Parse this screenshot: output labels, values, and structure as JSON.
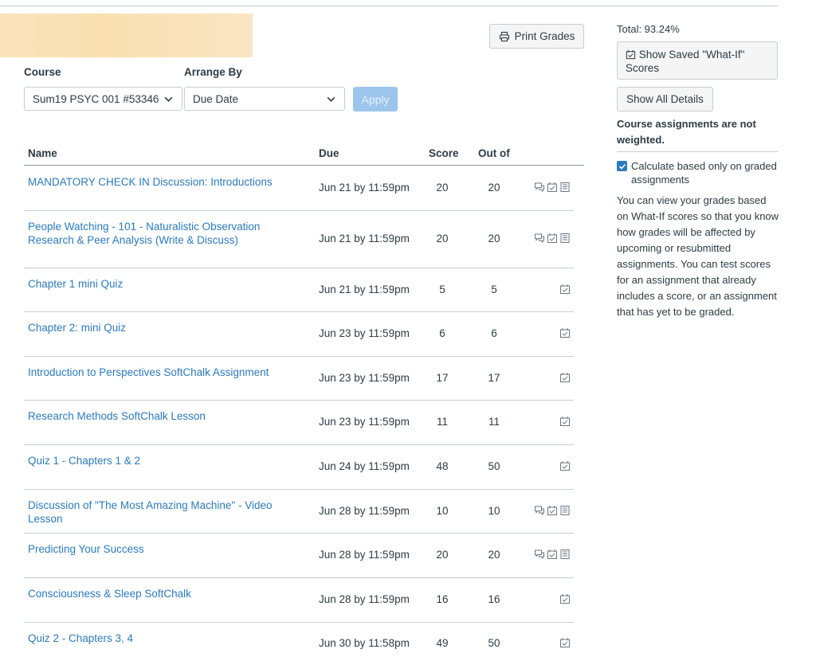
{
  "header": {
    "total_label": "Total: 93.24%"
  },
  "filters": {
    "course_label": "Course",
    "course_value": "Sum19 PSYC 001 #53346",
    "arrange_label": "Arrange By",
    "arrange_value": "Due Date",
    "apply_label": "Apply"
  },
  "actions": {
    "print_label": "Print Grades",
    "whatif_label": "Show Saved \"What-If\" Scores",
    "all_details_label": "Show All Details"
  },
  "sidebar": {
    "not_weighted": "Course assignments are not weighted.",
    "calc_label": "Calculate based only on graded assignments",
    "calc_checked": true,
    "help_text": "You can view your grades based on What-If scores so that you know how grades will be affected by upcoming or resubmitted assignments. You can test scores for an assignment that already includes a score, or an assignment that has yet to be graded."
  },
  "table": {
    "columns": {
      "name": "Name",
      "due": "Due",
      "score": "Score",
      "outof": "Out of"
    },
    "rows": [
      {
        "name": "MANDATORY CHECK IN Discussion: Introductions",
        "due": "Jun 21 by 11:59pm",
        "score": "20",
        "outof": "20",
        "icons": [
          "comments-icon",
          "whatif-icon",
          "rubric-icon"
        ]
      },
      {
        "name": "People Watching - 101 - Naturalistic Observation Research & Peer Analysis (Write & Discuss)",
        "due": "Jun 21 by 11:59pm",
        "score": "20",
        "outof": "20",
        "icons": [
          "comments-icon",
          "whatif-icon",
          "rubric-icon"
        ]
      },
      {
        "name": "Chapter 1 mini Quiz",
        "due": "Jun 21 by 11:59pm",
        "score": "5",
        "outof": "5",
        "icons": [
          "whatif-icon"
        ]
      },
      {
        "name": "Chapter 2: mini Quiz",
        "due": "Jun 23 by 11:59pm",
        "score": "6",
        "outof": "6",
        "icons": [
          "whatif-icon"
        ]
      },
      {
        "name": "Introduction to Perspectives SoftChalk Assignment",
        "due": "Jun 23 by 11:59pm",
        "score": "17",
        "outof": "17",
        "icons": [
          "whatif-icon"
        ]
      },
      {
        "name": "Research Methods SoftChalk Lesson",
        "due": "Jun 23 by 11:59pm",
        "score": "11",
        "outof": "11",
        "icons": [
          "whatif-icon"
        ]
      },
      {
        "name": "Quiz 1 - Chapters 1 & 2",
        "due": "Jun 24 by 11:59pm",
        "score": "48",
        "outof": "50",
        "icons": [
          "whatif-icon"
        ]
      },
      {
        "name": "Discussion of \"The Most Amazing Machine\" - Video Lesson",
        "due": "Jun 28 by 11:59pm",
        "score": "10",
        "outof": "10",
        "icons": [
          "comments-icon",
          "whatif-icon",
          "rubric-icon"
        ]
      },
      {
        "name": "Predicting Your Success",
        "due": "Jun 28 by 11:59pm",
        "score": "20",
        "outof": "20",
        "icons": [
          "comments-icon",
          "whatif-icon",
          "rubric-icon"
        ]
      },
      {
        "name": "Consciousness & Sleep SoftChalk",
        "due": "Jun 28 by 11:59pm",
        "score": "16",
        "outof": "16",
        "icons": [
          "whatif-icon"
        ]
      },
      {
        "name": "Quiz 2 - Chapters 3, 4",
        "due": "Jun 30 by 11:58pm",
        "score": "49",
        "outof": "50",
        "icons": [
          "whatif-icon"
        ]
      }
    ]
  },
  "colors": {
    "link": "#2b7abc",
    "apply_disabled": "#9cc5ec",
    "text": "#2d3b45",
    "banner": "#fbe4bd"
  }
}
